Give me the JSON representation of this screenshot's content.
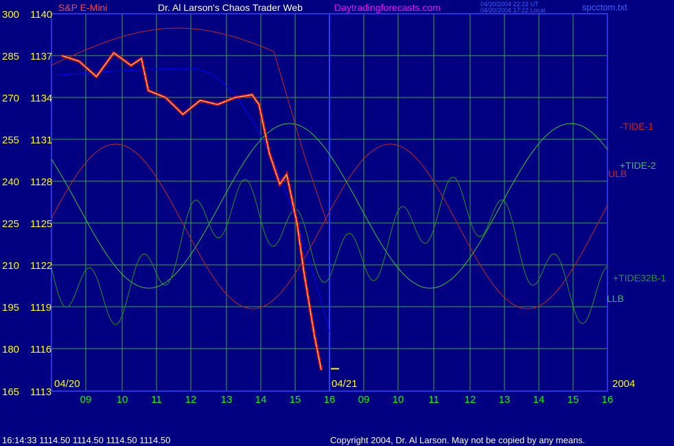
{
  "header": {
    "symbol": "S&P E-Mini",
    "title": "Dr. Al Larson's Chaos Trader Web",
    "site": "Daytradingforecasts.com",
    "timestamp_ut": "04/20/2004 22:22 UT",
    "timestamp_local": "04/20/2004 17:22 Local",
    "filename": "spcctom.txt"
  },
  "footer": {
    "quote": "16:14:33  1114.50 1114.50 1114.50 1114.50",
    "copyright": "Copyright 2004, Dr. Al Larson. May not be copied by any means."
  },
  "colors": {
    "background": "#000080",
    "grid": "#3aa83a",
    "left_axis_labels": "#ffff00",
    "bottom_axis_labels": "#00ff00",
    "price": "#ff0000",
    "price_up": "#ffffff",
    "ma": "#ffff99",
    "ma_long": "#0000ff",
    "tide1": "#cc2222",
    "tide2": "#33cc33",
    "tide32b": "#229922",
    "envelope": "#cc2222",
    "title": "#ffffff",
    "site": "#ff00ff"
  },
  "chart_data": {
    "type": "line",
    "grid": true,
    "y_left_outer_ticks": [
      "300",
      "285",
      "270",
      "255",
      "240",
      "225",
      "210",
      "195",
      "180",
      "165"
    ],
    "y_left_inner_ticks": [
      "1140",
      "1137",
      "1134",
      "1131",
      "1128",
      "1125",
      "1122",
      "1119",
      "1116",
      "1113"
    ],
    "ylim": [
      1113,
      1140
    ],
    "x_tick_labels": [
      "09",
      "10",
      "11",
      "12",
      "13",
      "14",
      "15",
      "16",
      "09",
      "10",
      "11",
      "12",
      "13",
      "14",
      "15",
      "16"
    ],
    "date_labels": [
      "04/20",
      "04/21"
    ],
    "year_label": "2004",
    "series_labels": [
      {
        "name": "-TIDE-1",
        "color": "#cc2222"
      },
      {
        "name": "+TIDE-2",
        "color": "#33cc33"
      },
      {
        "name": "ULB",
        "color": "#cc2222"
      },
      {
        "name": "+TIDE32B-1",
        "color": "#229922"
      },
      {
        "name": "LLB",
        "color": "#33cc33"
      }
    ],
    "price_series": {
      "name": "S&P E-Mini",
      "x_hour": [
        8.5,
        9.0,
        9.5,
        10.0,
        10.5,
        10.8,
        11.0,
        11.5,
        12.0,
        12.5,
        13.0,
        13.5,
        14.0,
        14.2,
        14.5,
        14.8,
        15.0,
        15.3,
        15.5,
        15.8,
        16.0
      ],
      "y": [
        1137.0,
        1136.6,
        1135.5,
        1137.2,
        1136.3,
        1136.8,
        1134.5,
        1134.0,
        1132.8,
        1133.8,
        1133.5,
        1134.0,
        1134.2,
        1133.5,
        1130.0,
        1127.8,
        1128.5,
        1125.0,
        1121.5,
        1117.0,
        1114.5
      ]
    },
    "last_price": 1114.5
  }
}
